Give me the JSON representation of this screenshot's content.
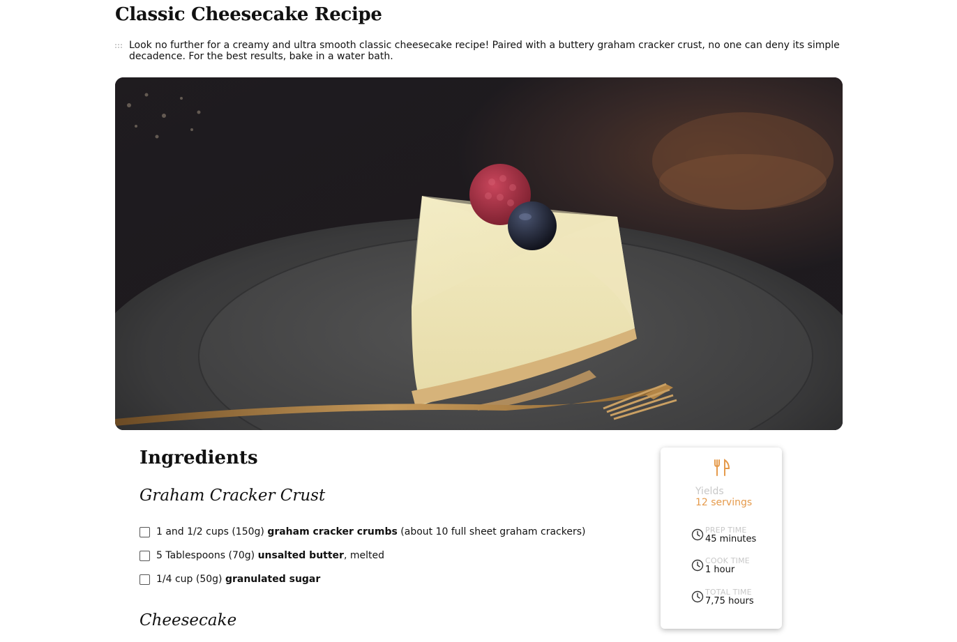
{
  "recipe": {
    "title": "Classic Cheesecake Recipe",
    "intro": "Look no further for a creamy and ultra smooth classic cheesecake recipe! Paired with a buttery graham cracker crust, no one can deny its simple decadence. For the best results, bake in a water bath.",
    "hero_image_alt": "slice of cheesecake topped with a raspberry and blueberry on a dark plate with a gold fork"
  },
  "ingredients": {
    "heading": "Ingredients",
    "groups": [
      {
        "title": "Graham Cracker Crust",
        "items": [
          {
            "pre": "1 and 1/2 cups (150g) ",
            "bold": "graham cracker crumbs",
            "post": " (about 10 full sheet graham crackers)"
          },
          {
            "pre": "5 Tablespoons (70g) ",
            "bold": "unsalted butter",
            "post": ", melted"
          },
          {
            "pre": "1/4 cup (50g) ",
            "bold": "granulated sugar",
            "post": ""
          }
        ]
      },
      {
        "title": "Cheesecake",
        "items": []
      }
    ]
  },
  "card": {
    "icon": "utensils-icon",
    "yields_label": "Yields",
    "yields_value": "12 servings",
    "times": [
      {
        "label": "PREP TIME",
        "value": "45 minutes"
      },
      {
        "label": "COOK TIME",
        "value": "1 hour"
      },
      {
        "label": "TOTAL TIME",
        "value": "7,75 hours"
      }
    ]
  },
  "colors": {
    "accent": "#e59a4b",
    "muted": "#c8c8c8",
    "text": "#111111"
  }
}
